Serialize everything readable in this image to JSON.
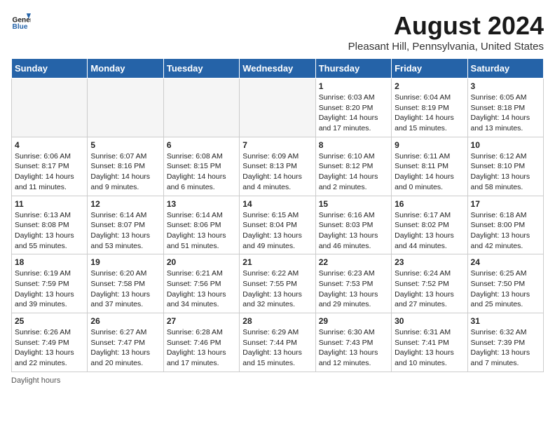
{
  "header": {
    "logo_line1": "General",
    "logo_line2": "Blue",
    "month_year": "August 2024",
    "location": "Pleasant Hill, Pennsylvania, United States"
  },
  "days_of_week": [
    "Sunday",
    "Monday",
    "Tuesday",
    "Wednesday",
    "Thursday",
    "Friday",
    "Saturday"
  ],
  "weeks": [
    [
      {
        "day": "",
        "info": ""
      },
      {
        "day": "",
        "info": ""
      },
      {
        "day": "",
        "info": ""
      },
      {
        "day": "",
        "info": ""
      },
      {
        "day": "1",
        "info": "Sunrise: 6:03 AM\nSunset: 8:20 PM\nDaylight: 14 hours and 17 minutes."
      },
      {
        "day": "2",
        "info": "Sunrise: 6:04 AM\nSunset: 8:19 PM\nDaylight: 14 hours and 15 minutes."
      },
      {
        "day": "3",
        "info": "Sunrise: 6:05 AM\nSunset: 8:18 PM\nDaylight: 14 hours and 13 minutes."
      }
    ],
    [
      {
        "day": "4",
        "info": "Sunrise: 6:06 AM\nSunset: 8:17 PM\nDaylight: 14 hours and 11 minutes."
      },
      {
        "day": "5",
        "info": "Sunrise: 6:07 AM\nSunset: 8:16 PM\nDaylight: 14 hours and 9 minutes."
      },
      {
        "day": "6",
        "info": "Sunrise: 6:08 AM\nSunset: 8:15 PM\nDaylight: 14 hours and 6 minutes."
      },
      {
        "day": "7",
        "info": "Sunrise: 6:09 AM\nSunset: 8:13 PM\nDaylight: 14 hours and 4 minutes."
      },
      {
        "day": "8",
        "info": "Sunrise: 6:10 AM\nSunset: 8:12 PM\nDaylight: 14 hours and 2 minutes."
      },
      {
        "day": "9",
        "info": "Sunrise: 6:11 AM\nSunset: 8:11 PM\nDaylight: 14 hours and 0 minutes."
      },
      {
        "day": "10",
        "info": "Sunrise: 6:12 AM\nSunset: 8:10 PM\nDaylight: 13 hours and 58 minutes."
      }
    ],
    [
      {
        "day": "11",
        "info": "Sunrise: 6:13 AM\nSunset: 8:08 PM\nDaylight: 13 hours and 55 minutes."
      },
      {
        "day": "12",
        "info": "Sunrise: 6:14 AM\nSunset: 8:07 PM\nDaylight: 13 hours and 53 minutes."
      },
      {
        "day": "13",
        "info": "Sunrise: 6:14 AM\nSunset: 8:06 PM\nDaylight: 13 hours and 51 minutes."
      },
      {
        "day": "14",
        "info": "Sunrise: 6:15 AM\nSunset: 8:04 PM\nDaylight: 13 hours and 49 minutes."
      },
      {
        "day": "15",
        "info": "Sunrise: 6:16 AM\nSunset: 8:03 PM\nDaylight: 13 hours and 46 minutes."
      },
      {
        "day": "16",
        "info": "Sunrise: 6:17 AM\nSunset: 8:02 PM\nDaylight: 13 hours and 44 minutes."
      },
      {
        "day": "17",
        "info": "Sunrise: 6:18 AM\nSunset: 8:00 PM\nDaylight: 13 hours and 42 minutes."
      }
    ],
    [
      {
        "day": "18",
        "info": "Sunrise: 6:19 AM\nSunset: 7:59 PM\nDaylight: 13 hours and 39 minutes."
      },
      {
        "day": "19",
        "info": "Sunrise: 6:20 AM\nSunset: 7:58 PM\nDaylight: 13 hours and 37 minutes."
      },
      {
        "day": "20",
        "info": "Sunrise: 6:21 AM\nSunset: 7:56 PM\nDaylight: 13 hours and 34 minutes."
      },
      {
        "day": "21",
        "info": "Sunrise: 6:22 AM\nSunset: 7:55 PM\nDaylight: 13 hours and 32 minutes."
      },
      {
        "day": "22",
        "info": "Sunrise: 6:23 AM\nSunset: 7:53 PM\nDaylight: 13 hours and 29 minutes."
      },
      {
        "day": "23",
        "info": "Sunrise: 6:24 AM\nSunset: 7:52 PM\nDaylight: 13 hours and 27 minutes."
      },
      {
        "day": "24",
        "info": "Sunrise: 6:25 AM\nSunset: 7:50 PM\nDaylight: 13 hours and 25 minutes."
      }
    ],
    [
      {
        "day": "25",
        "info": "Sunrise: 6:26 AM\nSunset: 7:49 PM\nDaylight: 13 hours and 22 minutes."
      },
      {
        "day": "26",
        "info": "Sunrise: 6:27 AM\nSunset: 7:47 PM\nDaylight: 13 hours and 20 minutes."
      },
      {
        "day": "27",
        "info": "Sunrise: 6:28 AM\nSunset: 7:46 PM\nDaylight: 13 hours and 17 minutes."
      },
      {
        "day": "28",
        "info": "Sunrise: 6:29 AM\nSunset: 7:44 PM\nDaylight: 13 hours and 15 minutes."
      },
      {
        "day": "29",
        "info": "Sunrise: 6:30 AM\nSunset: 7:43 PM\nDaylight: 13 hours and 12 minutes."
      },
      {
        "day": "30",
        "info": "Sunrise: 6:31 AM\nSunset: 7:41 PM\nDaylight: 13 hours and 10 minutes."
      },
      {
        "day": "31",
        "info": "Sunrise: 6:32 AM\nSunset: 7:39 PM\nDaylight: 13 hours and 7 minutes."
      }
    ]
  ],
  "footer": {
    "note": "Daylight hours"
  }
}
